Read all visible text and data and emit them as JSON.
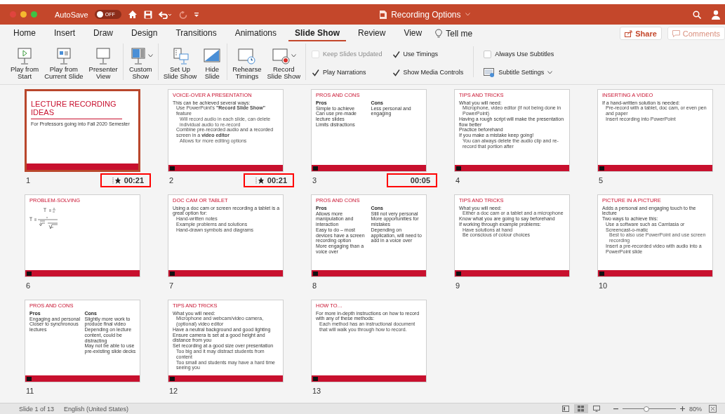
{
  "title_bar": {
    "autosave_label": "AutoSave",
    "autosave_on": false,
    "autosave_state": "OFF",
    "document_title": "Recording Options"
  },
  "tabs": [
    {
      "label": "Home",
      "selected": false
    },
    {
      "label": "Insert",
      "selected": false
    },
    {
      "label": "Draw",
      "selected": false
    },
    {
      "label": "Design",
      "selected": false
    },
    {
      "label": "Transitions",
      "selected": false
    },
    {
      "label": "Animations",
      "selected": false
    },
    {
      "label": "Slide Show",
      "selected": true
    },
    {
      "label": "Review",
      "selected": false
    },
    {
      "label": "View",
      "selected": false
    }
  ],
  "tell_me": "Tell me",
  "share_button": "Share",
  "comments_button": "Comments",
  "ribbon": {
    "groups": [
      [
        {
          "label": "Play from\nStart",
          "has_menu": false
        },
        {
          "label": "Play from\nCurrent Slide",
          "has_menu": false
        },
        {
          "label": "Presenter\nView",
          "has_menu": false
        }
      ],
      [
        {
          "label": "Custom\nShow",
          "has_menu": true
        }
      ],
      [
        {
          "label": "Set Up\nSlide Show",
          "has_menu": false
        },
        {
          "label": "Hide\nSlide",
          "has_menu": false
        }
      ],
      [
        {
          "label": "Rehearse\nTimings",
          "has_menu": false
        },
        {
          "label": "Record\nSlide Show",
          "has_menu": true
        }
      ]
    ],
    "options": [
      {
        "kind": "checkbox",
        "label": "Keep Slides Updated",
        "checked": false,
        "disabled": true
      },
      {
        "kind": "checkbox",
        "label": "Play Narrations",
        "checked": true,
        "disabled": false
      },
      {
        "kind": "checkbox",
        "label": "Use Timings",
        "checked": true,
        "disabled": false
      },
      {
        "kind": "checkbox",
        "label": "Show Media Controls",
        "checked": true,
        "disabled": false
      },
      {
        "kind": "divider"
      },
      {
        "kind": "checkbox",
        "label": "Always Use Subtitles",
        "checked": false,
        "disabled": false
      },
      {
        "kind": "menu",
        "label": "Subtitle Settings"
      }
    ]
  },
  "slides": [
    {
      "number": "1",
      "selected": true,
      "kind": "title",
      "title": "LECTURE RECORDING IDEAS",
      "subtitle": "For Professors going into Fall 2020 Semester",
      "timing": {
        "text": "00:21",
        "animated": true,
        "highlighted": true
      }
    },
    {
      "number": "2",
      "selected": false,
      "kind": "bullets",
      "title": "VOICE-OVER A PRESENTATION",
      "bullets": [
        {
          "text": "This can be achieved several ways:",
          "children": [
            {
              "text": "Use PowerPoint's **\"Record Slide Show\"** feature",
              "children": [
                {
                  "text": "Will record audio in each slide, can delete individual audio to re-record"
                }
              ]
            },
            {
              "text": "Combine pre-recorded audio and a recorded screen in a **video editor**",
              "children": [
                {
                  "text": "Allows for more editing options"
                }
              ]
            }
          ]
        }
      ],
      "timing": {
        "text": "00:21",
        "animated": true,
        "highlighted": true
      }
    },
    {
      "number": "3",
      "selected": false,
      "kind": "two_column",
      "title": "PROS AND CONS",
      "columns": [
        {
          "heading": "Pros",
          "bullets": [
            {
              "text": "Simple to achieve"
            },
            {
              "text": "Can use pre-made lecture slides"
            },
            {
              "text": "Limits distractions"
            }
          ]
        },
        {
          "heading": "Cons",
          "bullets": [
            {
              "text": "Less personal and engaging"
            }
          ]
        }
      ],
      "timing": {
        "text": "00:05",
        "animated": false,
        "highlighted": true
      }
    },
    {
      "number": "4",
      "selected": false,
      "kind": "bullets",
      "title": "TIPS AND TRICKS",
      "bullets": [
        {
          "text": "What you will need:",
          "children": [
            {
              "text": "Microphone, video editor (if not being done in PowerPoint)"
            }
          ]
        },
        {
          "text": "Having a rough script will make the presentation flow better"
        },
        {
          "text": "Practice beforehand"
        },
        {
          "text": "If you make a mistake keep going!",
          "children": [
            {
              "text": "You can always delete the audio clip and re-record that portion after"
            }
          ]
        }
      ]
    },
    {
      "number": "5",
      "selected": false,
      "kind": "bullets",
      "title": "INSERTING A VIDEO",
      "bullets": [
        {
          "text": "If a hand-written solution is needed:",
          "children": [
            {
              "text": "Pre-record with a tablet, doc cam, or even pen and paper"
            },
            {
              "text": "Insert recording into PowerPoint"
            }
          ]
        }
      ]
    },
    {
      "number": "6",
      "selected": false,
      "kind": "equation",
      "title": "PROBLEM-SOLVING"
    },
    {
      "number": "7",
      "selected": false,
      "kind": "bullets",
      "title": "DOC CAM OR TABLET",
      "bullets": [
        {
          "text": "Using a doc cam or screen recording a tablet is a great option for:",
          "children": [
            {
              "text": "Hand-written notes"
            },
            {
              "text": "Example problems and solutions"
            },
            {
              "text": "Hand-drawn symbols and diagrams"
            }
          ]
        }
      ]
    },
    {
      "number": "8",
      "selected": false,
      "kind": "two_column",
      "title": "PROS AND CONS",
      "columns": [
        {
          "heading": "Pros",
          "bullets": [
            {
              "text": "Allows more manipulation and interaction"
            },
            {
              "text": "Easy to do – most devices have a screen recording option"
            },
            {
              "text": "More engaging than a voice over"
            }
          ]
        },
        {
          "heading": "Cons",
          "bullets": [
            {
              "text": "Still not very personal"
            },
            {
              "text": "More opportunities for mistakes"
            },
            {
              "text": "Depending on application, will need to add in a voice over"
            }
          ]
        }
      ]
    },
    {
      "number": "9",
      "selected": false,
      "kind": "bullets",
      "title": "TIPS AND TRICKS",
      "bullets": [
        {
          "text": "What you will need:",
          "children": [
            {
              "text": "Either a doc cam or a tablet and a microphone"
            }
          ]
        },
        {
          "text": "Know what you are going to say beforehand"
        },
        {
          "text": "If working through example problems:",
          "children": [
            {
              "text": "Have solutions at hand"
            },
            {
              "text": "Be conscious of colour choices"
            }
          ]
        }
      ]
    },
    {
      "number": "10",
      "selected": false,
      "kind": "bullets",
      "title": "PICTURE IN A PICTURE",
      "bullets": [
        {
          "text": "Adds a personal and engaging touch to the lecture"
        },
        {
          "text": "Two ways to achieve this:",
          "children": [
            {
              "text": "Use a software such as Camtasia or Screencast-o-matic",
              "children": [
                {
                  "text": "Best to also use PowerPoint and use screen recording"
                }
              ]
            },
            {
              "text": "Insert a pre-recorded video with audio into a PowerPoint slide"
            }
          ]
        }
      ]
    },
    {
      "number": "11",
      "selected": false,
      "kind": "two_column",
      "title": "PROS AND CONS",
      "columns": [
        {
          "heading": "Pros",
          "bullets": [
            {
              "text": "Engaging and personal"
            },
            {
              "text": "Closer to synchronous lectures"
            }
          ]
        },
        {
          "heading": "Cons",
          "bullets": [
            {
              "text": "Slightly more work to produce final video"
            },
            {
              "text": "Depending on lecture content, could be distracting"
            },
            {
              "text": "May not be able to use pre-existing slide decks"
            }
          ]
        }
      ]
    },
    {
      "number": "12",
      "selected": false,
      "kind": "bullets",
      "title": "TIPS AND TRICKS",
      "bullets": [
        {
          "text": "What you will need:",
          "children": [
            {
              "text": "Microphone and webcam/video camera, (optional) video editor"
            }
          ]
        },
        {
          "text": "Have a neutral background and good lighting"
        },
        {
          "text": "Ensure camera is set at a good height and distance from you"
        },
        {
          "text": "Set recording at a good size over presentation",
          "children": [
            {
              "text": "Too big and it may distract students from content"
            },
            {
              "text": "Too small and students may have a hard time seeing you"
            }
          ]
        }
      ]
    },
    {
      "number": "13",
      "selected": false,
      "kind": "bullets",
      "title": "HOW TO…",
      "bullets": [
        {
          "text": "For more in-depth instructions on how to record with any of these methods:",
          "children": [
            {
              "text": "Each method has an instructional document that will walk you through how to record."
            }
          ]
        }
      ]
    }
  ],
  "status_bar": {
    "slide_indicator": "Slide 1 of 13",
    "language": "English (United States)",
    "views": [
      {
        "selected": false
      },
      {
        "selected": true
      },
      {
        "selected": false
      }
    ],
    "zoom": {
      "level": 0.45,
      "reading": "80%"
    }
  }
}
